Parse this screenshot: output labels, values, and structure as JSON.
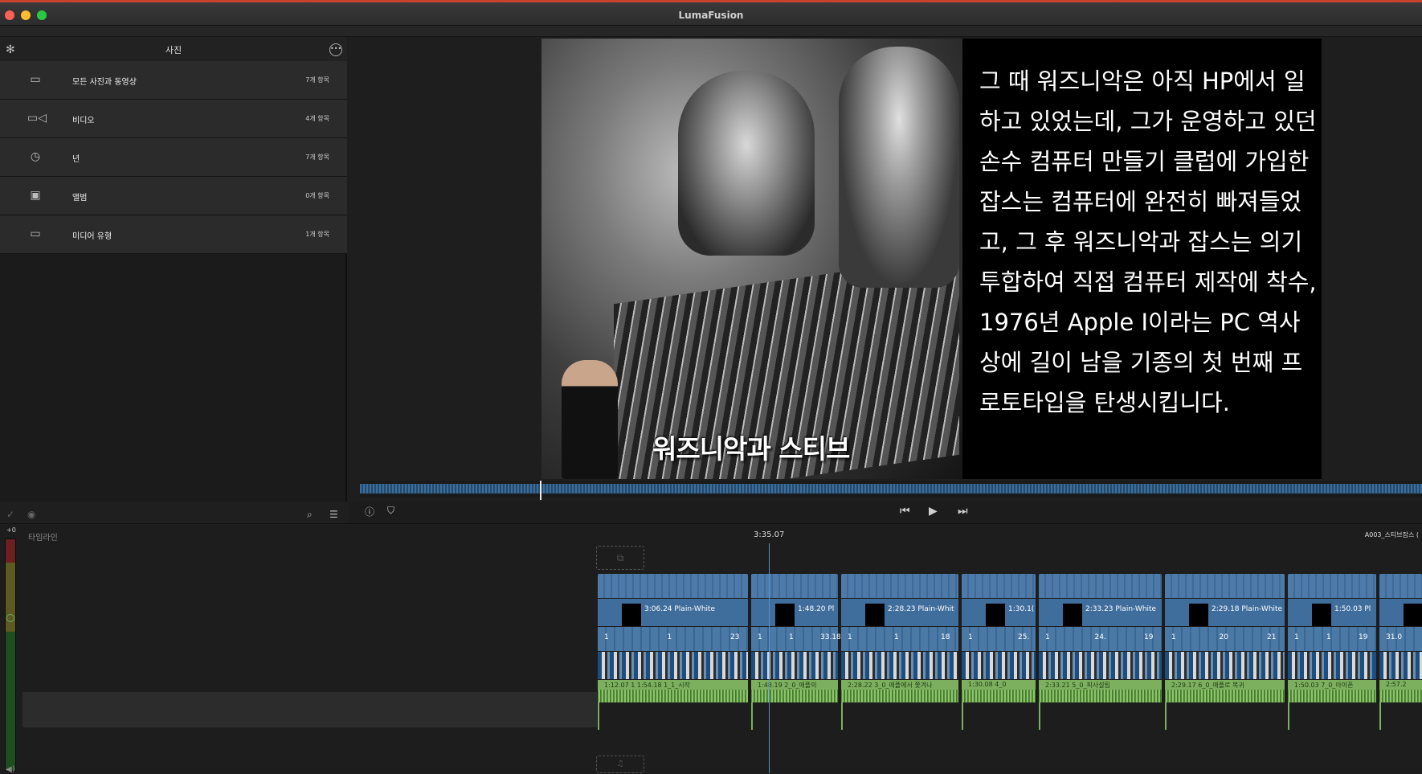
{
  "window": {
    "title": "LumaFusion"
  },
  "library": {
    "title": "사진",
    "settings_icon": "gear-icon",
    "more_icon": "ellipsis-circle-icon",
    "rows": [
      {
        "icon": "folder-icon",
        "label": "모든 사진과 동영상",
        "count": "7개 항목"
      },
      {
        "icon": "video-camera-icon",
        "label": "비디오",
        "count": "4개 항목"
      },
      {
        "icon": "calendar-photo-icon",
        "label": "년",
        "count": "7개 항목"
      },
      {
        "icon": "album-icon",
        "label": "앨범",
        "count": "0개 항목"
      },
      {
        "icon": "folder-icon",
        "label": "미디어 유형",
        "count": "1개 항목"
      }
    ]
  },
  "viewer": {
    "caption": "워즈니악과 스티브",
    "narration": "그 때 워즈니악은 아직 HP에서 일하고 있었는데, 그가 운영하고 있던 손수 컴퓨터 만들기 클럽에 가입한 잡스는 컴퓨터에 완전히 빠져들었고, 그 후 워즈니악과 잡스는 의기투합하여 직접 컴퓨터 제작에 착수, 1976년 Apple I이라는 PC 역사상에 길이 남을 기종의 첫 번째 프로토타입을 탄생시킵니다."
  },
  "timeline": {
    "label": "타임라인",
    "meter_label": "+0",
    "current_time": "3:35.07",
    "clip_name": "A003_스티브잡스 (",
    "clips": [
      {
        "duration": "3:06.24",
        "name": "Plain-White",
        "low": [
          "1",
          "1",
          "23"
        ],
        "audio": "1:12.07  1  1:54.18  1_1_시작"
      },
      {
        "duration": "1:48.20",
        "name": "Pl",
        "low": [
          "1",
          "1",
          "33.18"
        ],
        "audio": "1:48.19  2_0_애플의"
      },
      {
        "duration": "2:28.23",
        "name": "Plain-Whit",
        "low": [
          "1",
          "1",
          "18"
        ],
        "audio": "2:28.22  3_0_애플에서 쫓겨나"
      },
      {
        "duration": "1:30.1(",
        "name": "",
        "low": [
          "1",
          "25."
        ],
        "audio": "1:30.08  4_0"
      },
      {
        "duration": "2:33.23",
        "name": "Plain-White",
        "low": [
          "1",
          "24.",
          "19"
        ],
        "audio": "2:33.21  5_0_픽사설립"
      },
      {
        "duration": "2:29.18",
        "name": "Plain-White",
        "low": [
          "1",
          "20",
          "21"
        ],
        "audio": "2:29.17  6_0_애플로 복귀"
      },
      {
        "duration": "1:50.03",
        "name": "Pl",
        "low": [
          "1",
          "1",
          "19"
        ],
        "audio": "1:50.03  7_0_아이폰"
      },
      {
        "duration": "",
        "name": "",
        "low": [
          "31.0"
        ],
        "audio": "2:57.2"
      }
    ]
  }
}
